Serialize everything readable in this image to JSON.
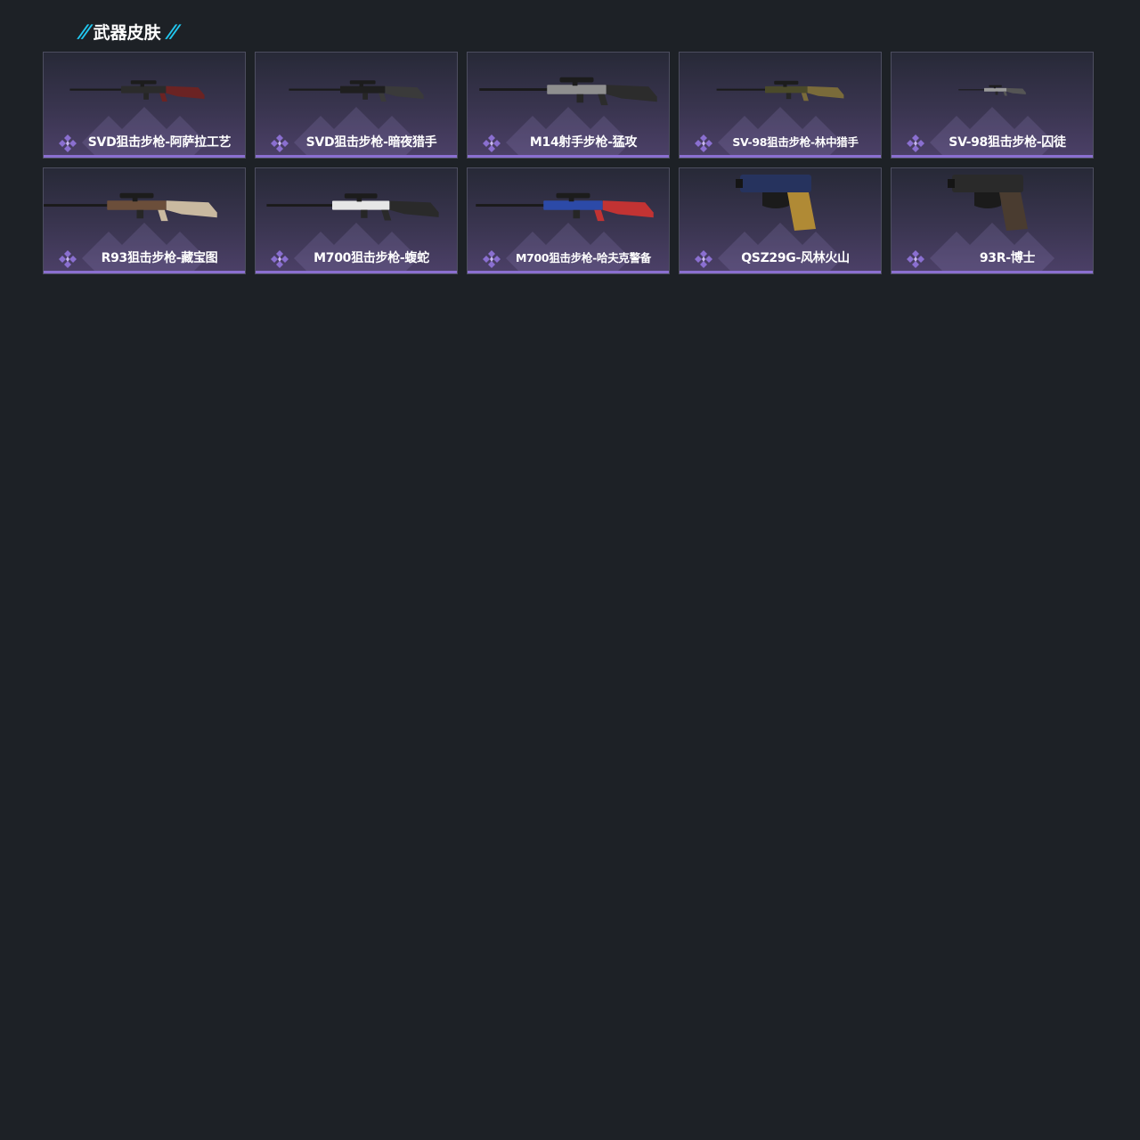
{
  "section": {
    "title": "武器皮肤"
  },
  "colors": {
    "accent": "#21c8f0",
    "rarity_purple": "#8a6fd0",
    "background": "#1d2126"
  },
  "rarity_icon": "diamond-cluster-icon",
  "skins": [
    {
      "name": "SVD狙击步枪-阿萨拉工艺",
      "type": "rifle",
      "icon": "svd-sniper-rifle-icon"
    },
    {
      "name": "SVD狙击步枪-暗夜猎手",
      "type": "rifle",
      "icon": "svd-sniper-rifle-icon"
    },
    {
      "name": "M14射手步枪-猛攻",
      "type": "rifle",
      "icon": "m14-rifle-icon"
    },
    {
      "name": "SV-98狙击步枪-林中猎手",
      "type": "rifle",
      "icon": "sv98-sniper-rifle-icon"
    },
    {
      "name": "SV-98狙击步枪-囚徒",
      "type": "rifle",
      "icon": "sv98-sniper-rifle-icon"
    },
    {
      "name": "R93狙击步枪-藏宝图",
      "type": "rifle",
      "icon": "r93-sniper-rifle-icon"
    },
    {
      "name": "M700狙击步枪-蝮蛇",
      "type": "rifle",
      "icon": "m700-sniper-rifle-icon"
    },
    {
      "name": "M700狙击步枪-哈夫克警备",
      "type": "rifle",
      "icon": "m700-sniper-rifle-icon"
    },
    {
      "name": "QSZ29G-风林火山",
      "type": "pistol",
      "icon": "qsz29g-pistol-icon"
    },
    {
      "name": "93R-博士",
      "type": "pistol",
      "icon": "93r-pistol-icon"
    }
  ]
}
